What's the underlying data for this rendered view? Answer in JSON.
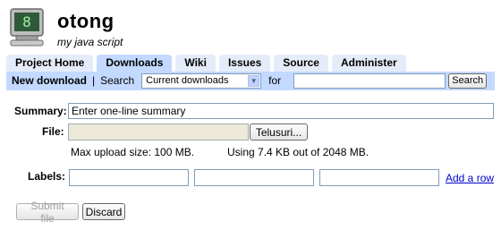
{
  "project": {
    "name": "otong",
    "summary": "my java script"
  },
  "tabs": [
    {
      "label": "Project Home",
      "active": false
    },
    {
      "label": "Downloads",
      "active": true
    },
    {
      "label": "Wiki",
      "active": false
    },
    {
      "label": "Issues",
      "active": false
    },
    {
      "label": "Source",
      "active": false
    },
    {
      "label": "Administer",
      "active": false
    }
  ],
  "subbar": {
    "new_download": "New download",
    "separator": "|",
    "search_label": "Search",
    "select_value": "Current downloads",
    "for_label": "for",
    "search_value": "",
    "search_button": "Search"
  },
  "form": {
    "summary_label": "Summary:",
    "summary_value": "Enter one-line summary",
    "file_label": "File:",
    "browse_button": "Telusuri...",
    "max_upload": "Max upload size: 100 MB.",
    "usage": "Using 7.4 KB out of 2048 MB.",
    "labels_label": "Labels:",
    "add_row": "Add a row",
    "submit_button": "Submit file",
    "discard_button": "Discard"
  },
  "colors": {
    "tab_active": "#c3d9ff",
    "tab_inactive": "#e5ecf9",
    "link": "#0000cc"
  }
}
